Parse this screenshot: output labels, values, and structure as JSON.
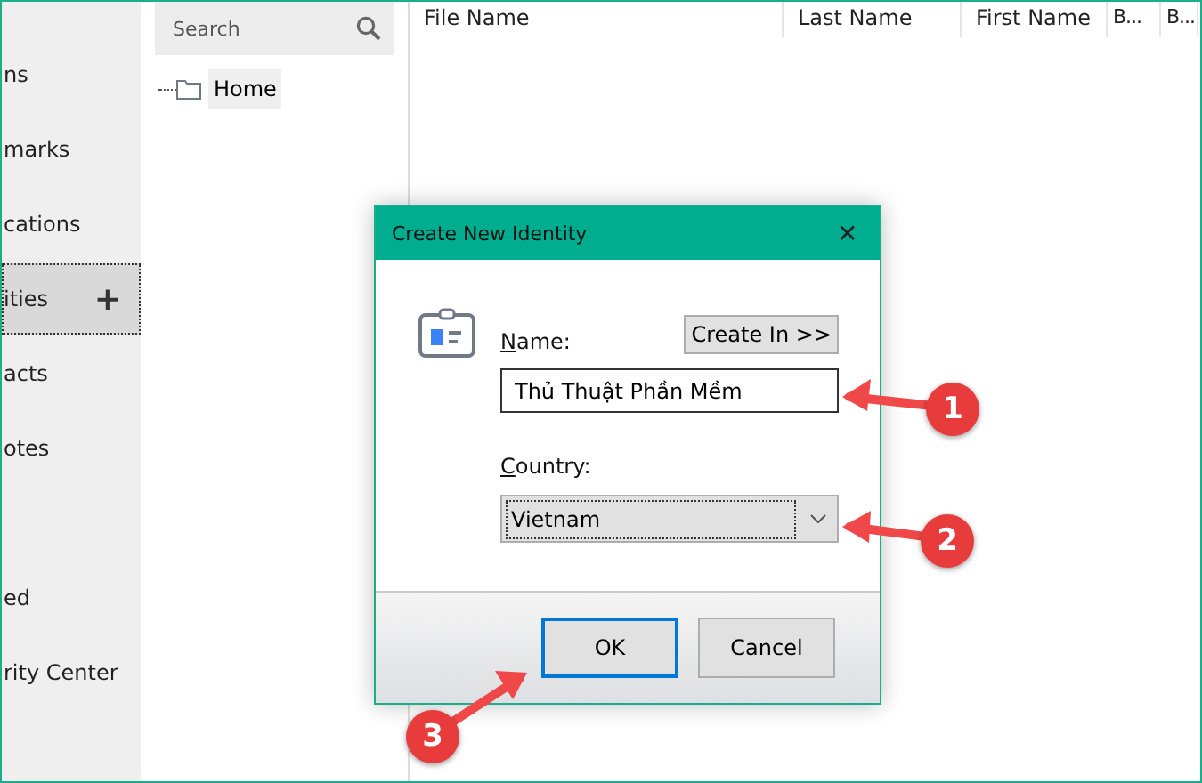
{
  "sidebar": {
    "items": [
      {
        "label": "ns",
        "selected": false
      },
      {
        "label": "marks",
        "selected": false
      },
      {
        "label": "cations",
        "selected": false
      },
      {
        "label": "ities",
        "selected": true,
        "action": "+"
      },
      {
        "label": "acts",
        "selected": false
      },
      {
        "label": "otes",
        "selected": false
      },
      {
        "label": "ed",
        "selected": false
      },
      {
        "label": "rity Center",
        "selected": false
      }
    ]
  },
  "tree": {
    "search": {
      "placeholder": "Search"
    },
    "items": [
      {
        "label": "Home",
        "selected": true
      }
    ]
  },
  "table": {
    "columns": [
      "File Name",
      "Last Name",
      "First Name",
      "B...",
      "B..."
    ]
  },
  "dialog": {
    "title": "Create New Identity",
    "close": "✕",
    "name_label": "Name:",
    "create_in_button": "Create In >>",
    "name_value": "Thủ Thuật Phần Mềm",
    "country_label": "Country:",
    "country_value": "Vietnam",
    "ok_button": "OK",
    "cancel_button": "Cancel"
  },
  "annotations": [
    {
      "number": "1"
    },
    {
      "number": "2"
    },
    {
      "number": "3"
    }
  ]
}
